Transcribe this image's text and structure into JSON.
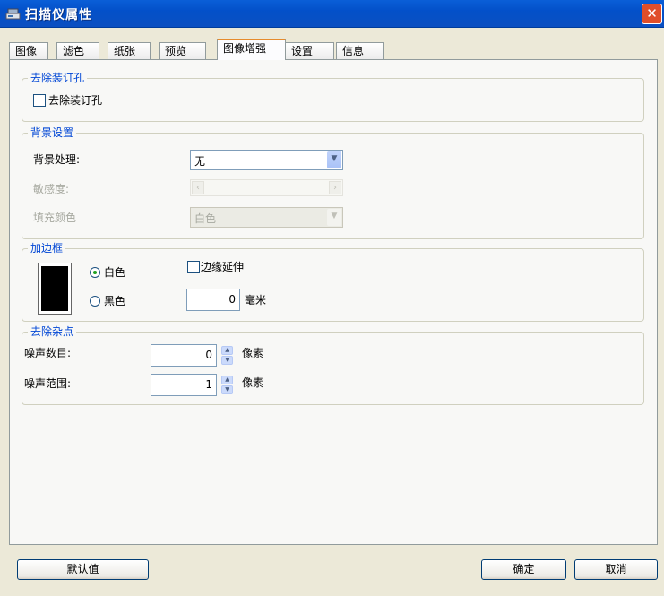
{
  "window": {
    "title": "扫描仪属性",
    "title_icon": "scanner-icon",
    "close_icon": "close-icon"
  },
  "tabs": [
    {
      "label": "图像"
    },
    {
      "label": "滤色"
    },
    {
      "label": "纸张"
    },
    {
      "label": "预览"
    },
    {
      "label": "图像增强",
      "active": true
    },
    {
      "label": "设置"
    },
    {
      "label": "信息"
    }
  ],
  "punch_hole": {
    "legend": "去除装订孔",
    "checkbox_label": "去除装订孔",
    "checked": false
  },
  "background": {
    "legend": "背景设置",
    "processing_label": "背景处理:",
    "processing_value": "无",
    "sensitivity_label": "敏感度:",
    "fill_color_label": "填充颜色",
    "fill_color_value": "白色"
  },
  "border": {
    "legend": "加边框",
    "white_label": "白色",
    "black_label": "黑色",
    "selected": "白色",
    "edge_extend_label": "边缘延伸",
    "edge_extend_checked": false,
    "width_value": "0",
    "width_unit": "毫米"
  },
  "despeckle": {
    "legend": "去除杂点",
    "noise_count_label": "噪声数目:",
    "noise_count_value": "0",
    "noise_count_unit": "像素",
    "noise_range_label": "噪声范围:",
    "noise_range_value": "1",
    "noise_range_unit": "像素"
  },
  "buttons": {
    "default": "默认值",
    "ok": "确定",
    "cancel": "取消"
  },
  "colors": {
    "title_bar": "#0553cc",
    "legend_text": "#0046d5",
    "active_tab_accent": "#e68b2c",
    "dialog_bg": "#ece9d8"
  }
}
